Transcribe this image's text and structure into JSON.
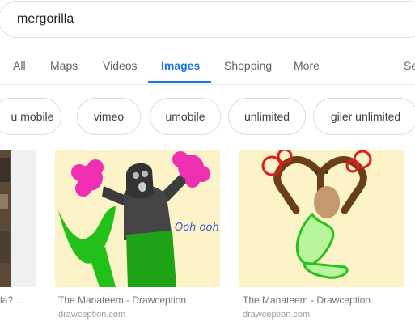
{
  "search": {
    "query": "mergorilla"
  },
  "tabs": [
    {
      "label": "All"
    },
    {
      "label": "Maps"
    },
    {
      "label": "Videos"
    },
    {
      "label": "Images"
    },
    {
      "label": "Shopping"
    },
    {
      "label": "More"
    },
    {
      "label": "Se"
    }
  ],
  "chips": [
    {
      "label": "u mobile"
    },
    {
      "label": "vimeo"
    },
    {
      "label": "umobile"
    },
    {
      "label": "unlimited"
    },
    {
      "label": "giler unlimited"
    }
  ],
  "results": [
    {
      "title": "la? ...",
      "source": ""
    },
    {
      "title": "The Manateem - Drawception",
      "source": "drawception.com",
      "drawing_text": "Ooh ooh ahh!"
    },
    {
      "title": "The Manateem - Drawception",
      "source": "drawception.com"
    }
  ],
  "colors": {
    "accent": "#1a73e8",
    "muted": "#5f6368"
  }
}
